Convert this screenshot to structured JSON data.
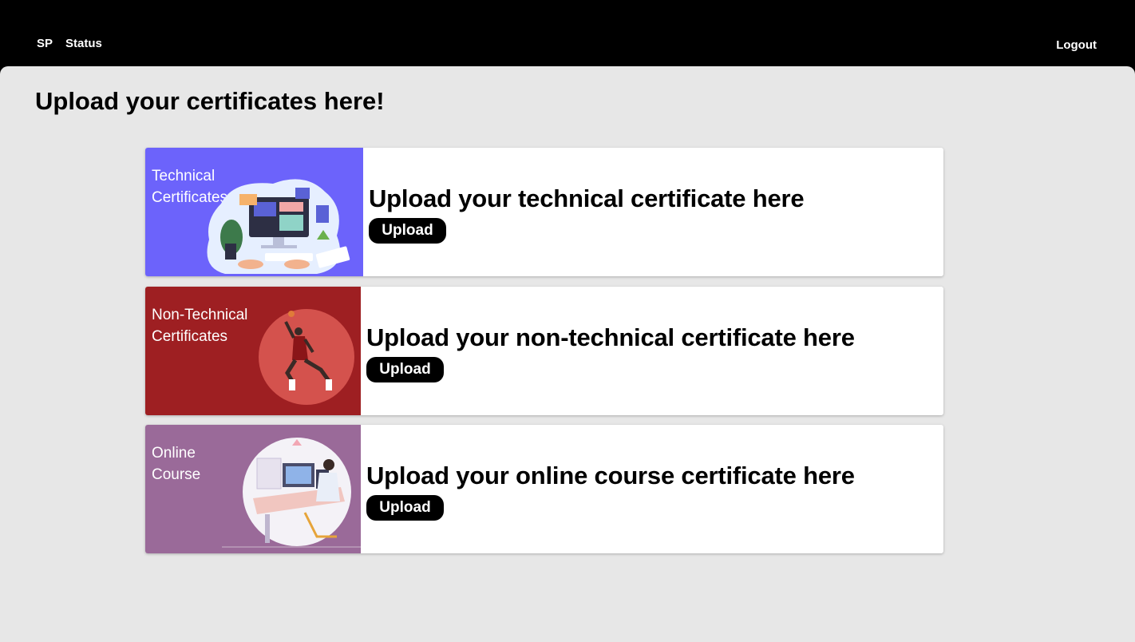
{
  "nav": {
    "brand": "SP",
    "status": "Status",
    "logout": "Logout"
  },
  "page": {
    "title": "Upload your certificates here!"
  },
  "cards": [
    {
      "image_label_line1": "Technical",
      "image_label_line2": "Certificates",
      "image_bg": "#6c63fb",
      "heading": "Upload your technical certificate here",
      "button": "Upload"
    },
    {
      "image_label_line1": "Non-Technical",
      "image_label_line2": "Certificates",
      "image_bg": "#9e1f22",
      "heading": "Upload your non-technical certificate here",
      "button": "Upload"
    },
    {
      "image_label_line1": "Online",
      "image_label_line2": "Course",
      "image_bg": "#9a6a99",
      "heading": "Upload your online course certificate here",
      "button": "Upload"
    }
  ]
}
